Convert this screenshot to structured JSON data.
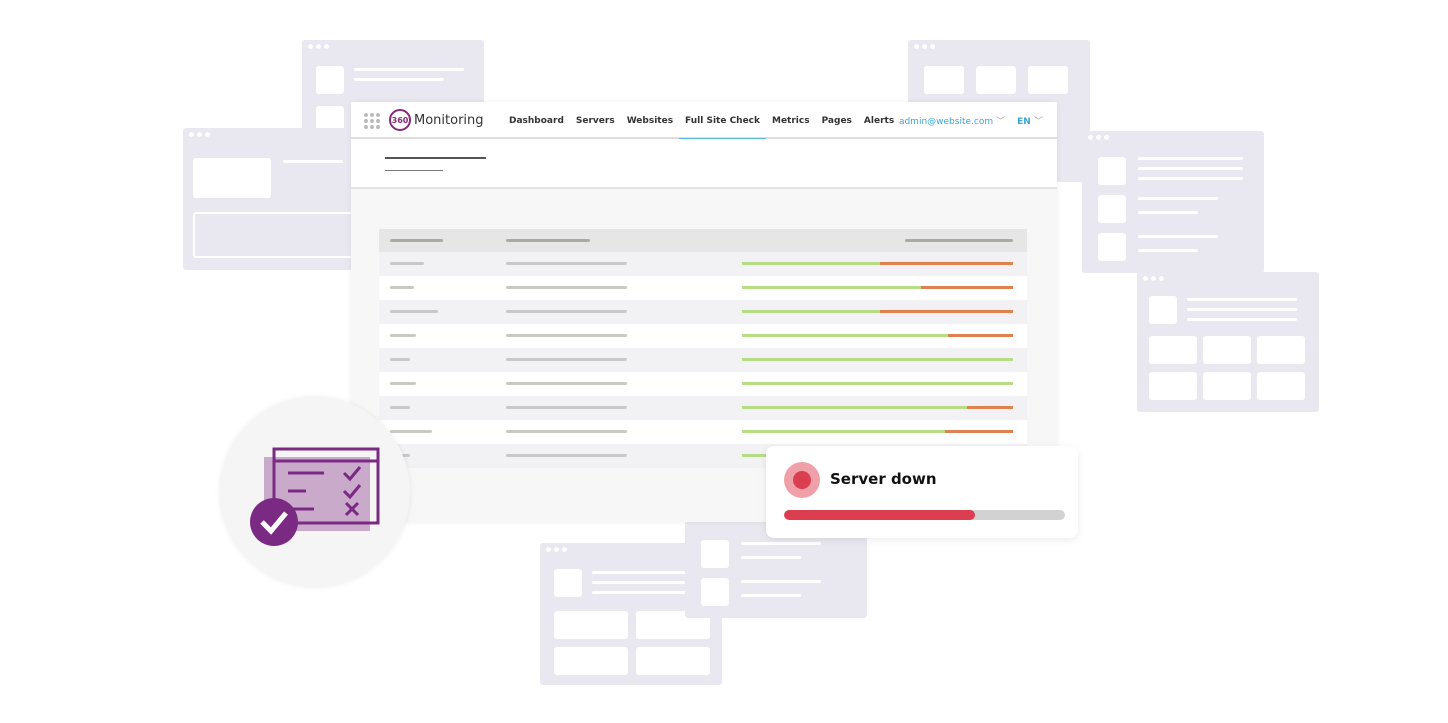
{
  "nav": {
    "logo_text": "Monitoring",
    "logo_badge": "360",
    "items": [
      {
        "label": "Dashboard"
      },
      {
        "label": "Servers"
      },
      {
        "label": "Websites"
      },
      {
        "label": "Full Site Check",
        "active": true
      },
      {
        "label": "Metrics"
      },
      {
        "label": "Pages"
      },
      {
        "label": "Alerts"
      }
    ],
    "user": "admin@website.com",
    "language": "EN"
  },
  "table": {
    "rows": [
      {
        "ok_percent": 51
      },
      {
        "ok_percent": 66
      },
      {
        "ok_percent": 51
      },
      {
        "ok_percent": 76
      },
      {
        "ok_percent": 100
      },
      {
        "ok_percent": 100
      },
      {
        "ok_percent": 83
      },
      {
        "ok_percent": 75
      },
      {
        "ok_percent": 100
      }
    ]
  },
  "alert": {
    "title": "Server down",
    "progress_percent": 68
  },
  "colors": {
    "accent": "#5bc0de",
    "ok": "#b8db86",
    "fail": "#e0814f",
    "alert": "#db3e4e",
    "brand": "#7b2a83"
  },
  "icons": {
    "feature": "checklist-window-check-icon"
  }
}
